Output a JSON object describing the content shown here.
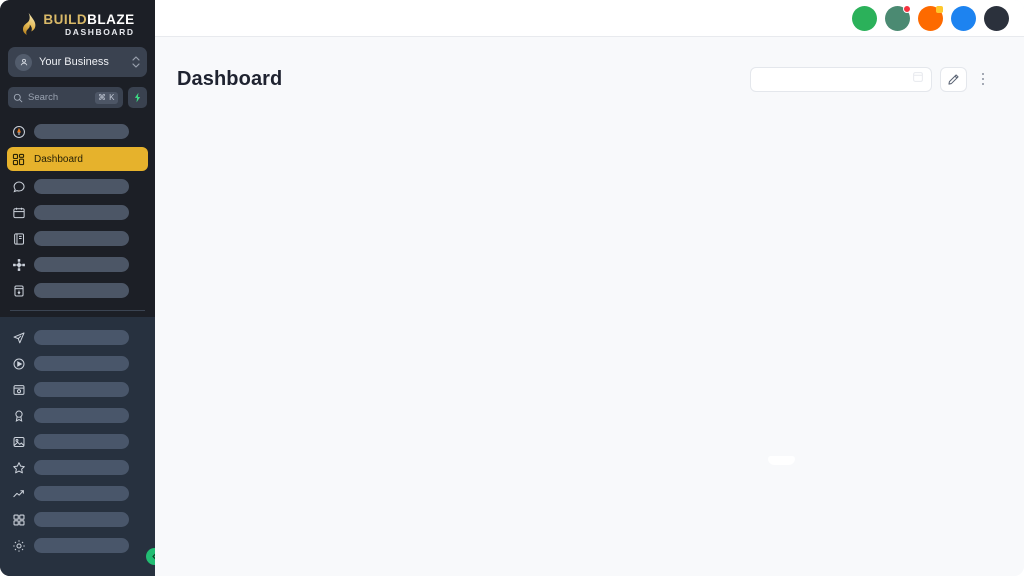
{
  "brand": {
    "name_part1": "BUILD",
    "name_part2": "BLAZE",
    "subtitle": "DASHBOARD",
    "flame_icon": "flame-icon",
    "gold": "#d9b968"
  },
  "sidebar": {
    "business_selector": {
      "label": "Your Business",
      "avatar_icon": "user-avatar-icon",
      "chevron_icon": "chevron-up-down-icon"
    },
    "search": {
      "placeholder": "Search",
      "shortcut": "⌘ K",
      "search_icon": "search-icon",
      "ai_icon": "sparkle-icon",
      "ai_color": "#3ddc84"
    },
    "primary_items": [
      {
        "icon": "compass-icon",
        "label": "",
        "loading": true,
        "active": false
      },
      {
        "icon": "grid-dashboard-icon",
        "label": "Dashboard",
        "loading": false,
        "active": true
      },
      {
        "icon": "chat-bubble-icon",
        "label": "",
        "loading": true,
        "active": false
      },
      {
        "icon": "calendar-icon",
        "label": "",
        "loading": true,
        "active": false
      },
      {
        "icon": "notebook-icon",
        "label": "",
        "loading": true,
        "active": false
      },
      {
        "icon": "workflow-nodes-icon",
        "label": "",
        "loading": true,
        "active": false
      },
      {
        "icon": "archive-box-icon",
        "label": "",
        "loading": true,
        "active": false
      }
    ],
    "secondary_items": [
      {
        "icon": "send-paper-plane-icon",
        "label": "",
        "loading": true
      },
      {
        "icon": "play-circle-icon",
        "label": "",
        "loading": true
      },
      {
        "icon": "storefront-icon",
        "label": "",
        "loading": true
      },
      {
        "icon": "award-ribbon-icon",
        "label": "",
        "loading": true
      },
      {
        "icon": "image-photo-icon",
        "label": "",
        "loading": true
      },
      {
        "icon": "star-icon",
        "label": "",
        "loading": true
      },
      {
        "icon": "trending-up-icon",
        "label": "",
        "loading": true
      },
      {
        "icon": "grid-apps-icon",
        "label": "",
        "loading": true
      },
      {
        "icon": "gear-settings-icon",
        "label": "",
        "loading": true
      }
    ],
    "collapse_button": {
      "icon": "chevron-left-icon",
      "color": "#22bd73"
    },
    "active_color": "#e6b22c",
    "background": "#1c1f26",
    "secondary_background": "#27313f"
  },
  "topbar": {
    "avatars": [
      {
        "name": "avatar-green",
        "color": "#2bb15a",
        "badge": null,
        "badge_color": null
      },
      {
        "name": "avatar-teal",
        "color": "#4b8a72",
        "badge": "notification-dot",
        "badge_color": "#f5333f"
      },
      {
        "name": "avatar-orange",
        "color": "#fd6a00",
        "badge": "status-square",
        "badge_color": "#ffc82c"
      },
      {
        "name": "avatar-blue",
        "color": "#1d83f0",
        "badge": null,
        "badge_color": null
      },
      {
        "name": "avatar-dark",
        "color": "#2b313c",
        "badge": null,
        "badge_color": null
      }
    ]
  },
  "main": {
    "page_title": "Dashboard",
    "controls": {
      "filter_input_value": "",
      "filter_input_placeholder": "",
      "filter_icon": "window-square-icon",
      "edit_button_icon": "pencil-edit-icon",
      "more_button_icon": "kebab-menu-icon"
    },
    "body": {
      "state": "empty",
      "background": "#f8f9fb"
    }
  }
}
